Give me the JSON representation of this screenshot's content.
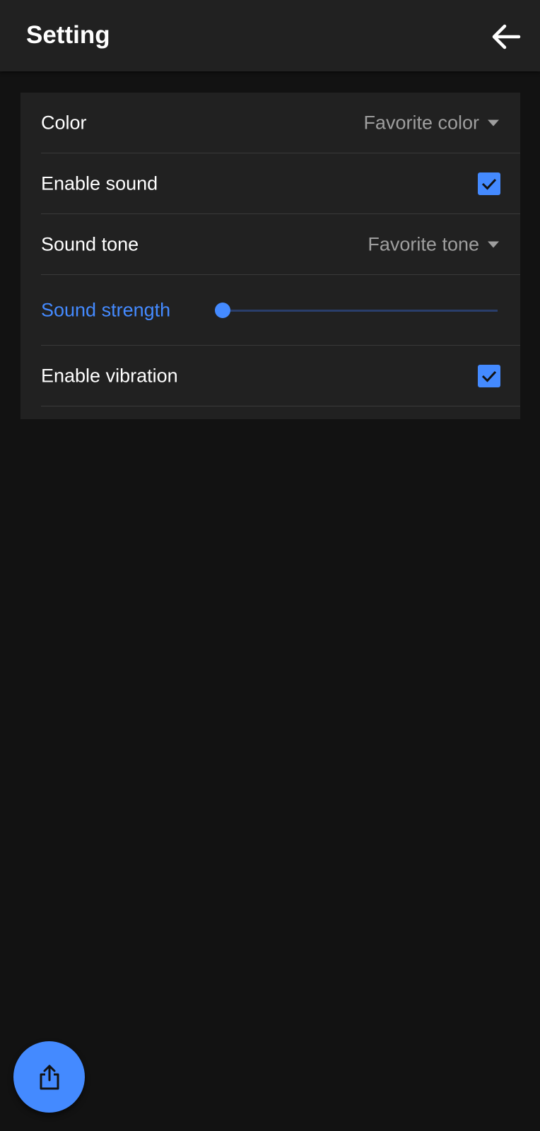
{
  "app_bar": {
    "title": "Setting",
    "back_icon": "arrow-back-icon"
  },
  "settings": {
    "color": {
      "label": "Color",
      "value": "Favorite color",
      "icon": "dropdown-caret-icon"
    },
    "enable_sound": {
      "label": "Enable sound",
      "checked": true,
      "icon": "check-icon"
    },
    "sound_tone": {
      "label": "Sound tone",
      "value": "Favorite tone",
      "icon": "dropdown-caret-icon"
    },
    "sound_strength": {
      "label": "Sound strength",
      "level": 0.0
    },
    "enable_vibration": {
      "label": "Enable vibration",
      "checked": true,
      "icon": "check-icon"
    }
  },
  "fab": {
    "icon": "share-icon"
  },
  "colors": {
    "accent": "#448aff",
    "background": "#121212",
    "surface": "#212121",
    "text_primary": "#ffffff",
    "text_secondary": "#9e9e9e"
  }
}
